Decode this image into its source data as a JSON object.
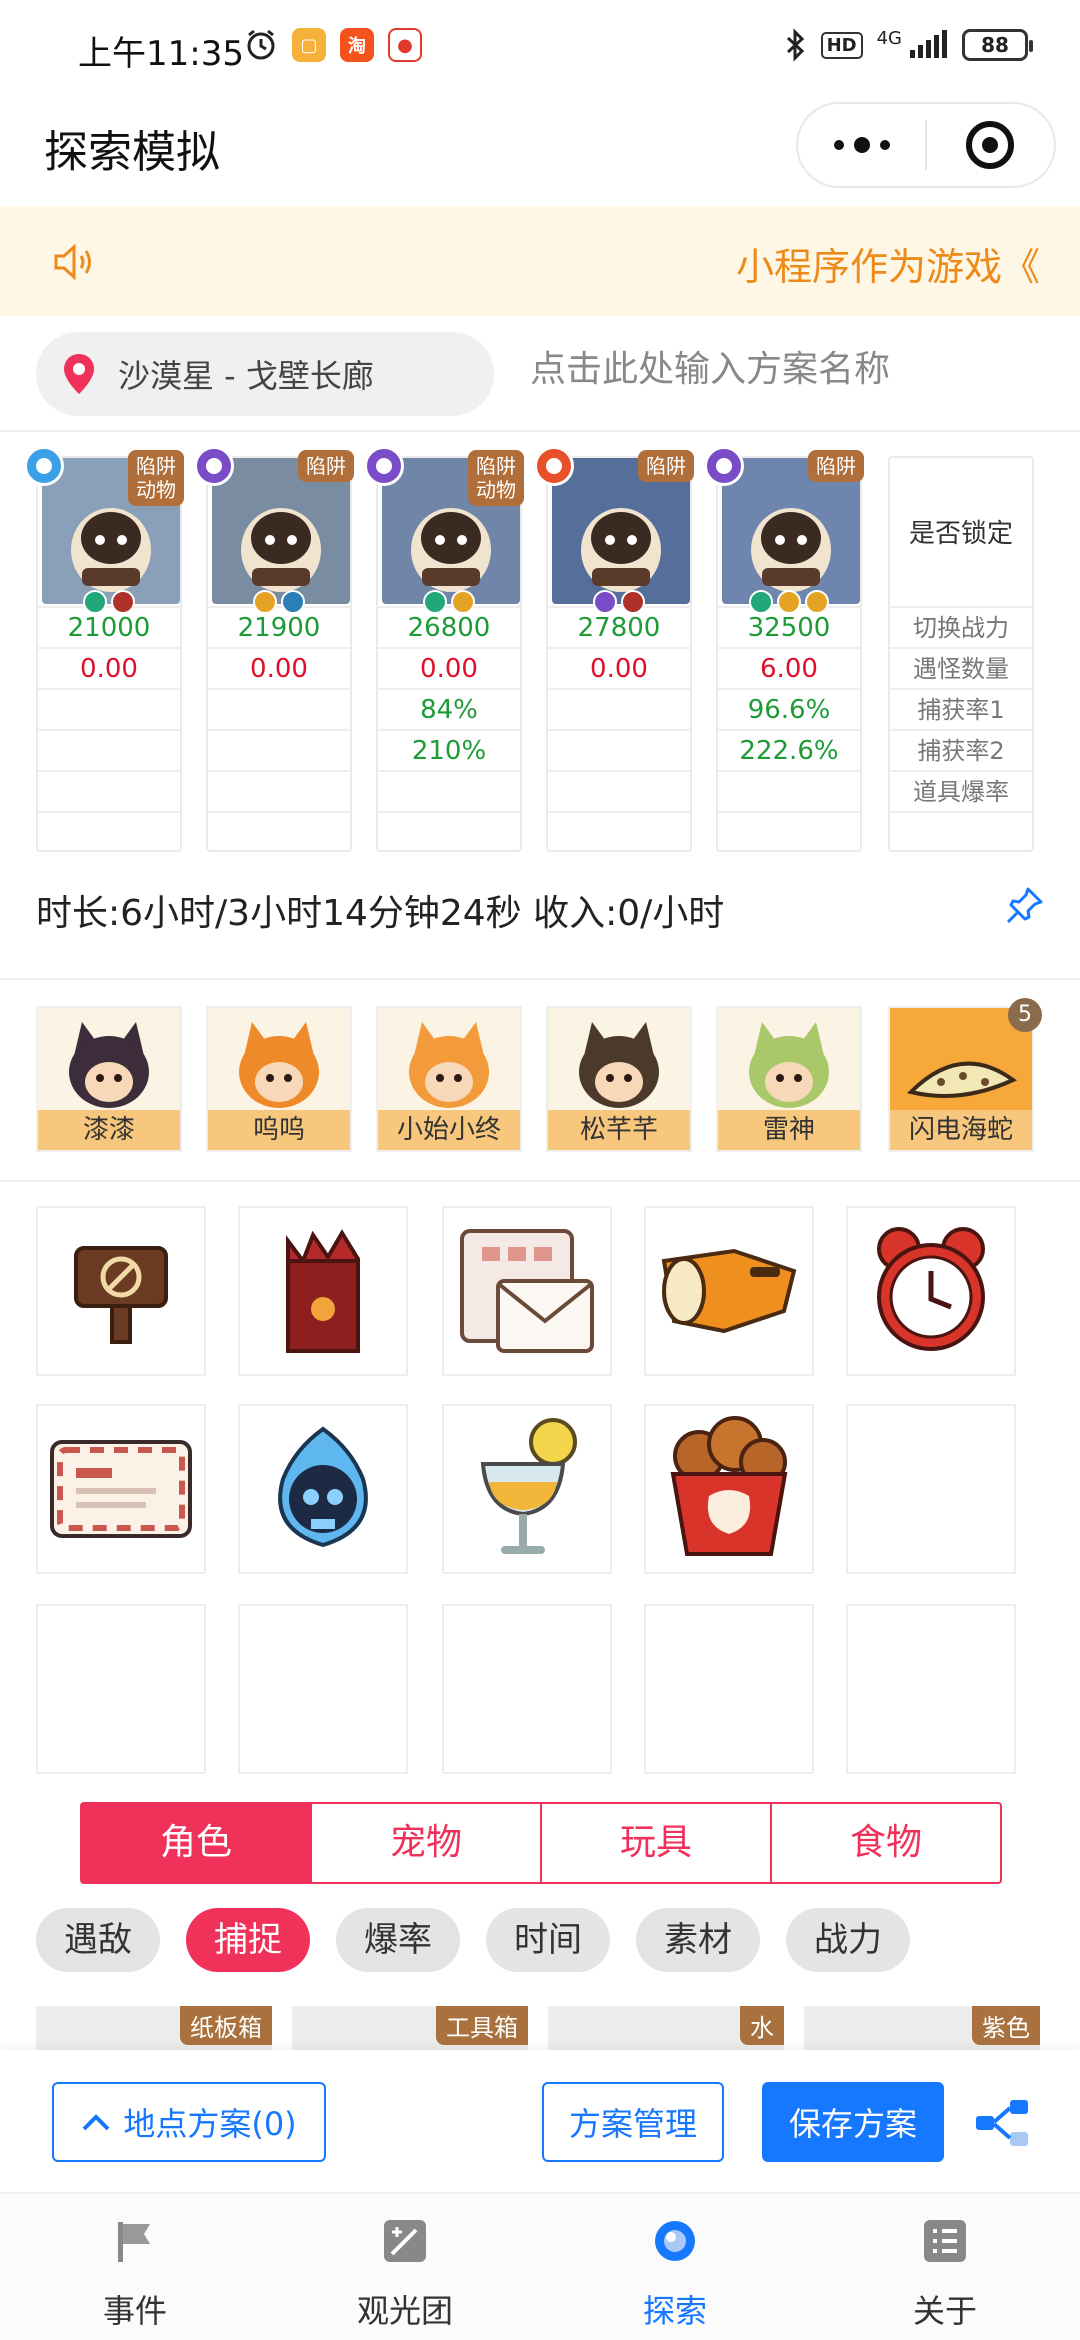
{
  "status_bar": {
    "time": "上午11:35",
    "network": "4G",
    "hd": "HD",
    "battery": "88",
    "apps": [
      "taobao-app-icon",
      "memo-app-icon",
      "red-envelope-app-icon"
    ]
  },
  "nav": {
    "title": "探索模拟"
  },
  "notice": {
    "text": "小程序作为游戏《"
  },
  "location": {
    "name": "沙漠星 - 戈壁长廊",
    "plan_placeholder": "点击此处输入方案名称"
  },
  "characters": [
    {
      "tag": "陷阱\n动物",
      "power": "21000",
      "monsters": "0.00",
      "catch1": "",
      "catch2": "",
      "badge_color": "#3aa0e8"
    },
    {
      "tag": "陷阱",
      "power": "21900",
      "monsters": "0.00",
      "catch1": "",
      "catch2": "",
      "badge_color": "#7a4cc8"
    },
    {
      "tag": "陷阱\n动物",
      "power": "26800",
      "monsters": "0.00",
      "catch1": "84%",
      "catch2": "210%",
      "badge_color": "#7a4cc8"
    },
    {
      "tag": "陷阱",
      "power": "27800",
      "monsters": "0.00",
      "catch1": "",
      "catch2": "",
      "badge_color": "#e8502a"
    },
    {
      "tag": "陷阱",
      "power": "32500",
      "monsters": "6.00",
      "catch1": "96.6%",
      "catch2": "222.6%",
      "badge_color": "#7a4cc8"
    }
  ],
  "lock_card": {
    "title": "是否锁定",
    "rows": [
      "切换战力",
      "遇怪数量",
      "捕获率1",
      "捕获率2",
      "道具爆率"
    ]
  },
  "duration_text": "时长:6小时/3小时14分钟24秒 收入:0/小时",
  "pets": [
    {
      "name": "漆漆"
    },
    {
      "name": "呜呜"
    },
    {
      "name": "小始小终"
    },
    {
      "name": "松芊芊"
    },
    {
      "name": "雷神"
    },
    {
      "name": "闪电海蛇",
      "count": "5"
    }
  ],
  "items": [
    "no-sign-board-icon",
    "red-bag-icon",
    "envelope-icon",
    "flashlight-icon",
    "alarm-clock-icon",
    "postcard-icon",
    "blue-skull-flame-icon",
    "lemon-drink-icon",
    "fried-chicken-bucket-icon",
    "",
    "",
    "",
    "",
    "",
    ""
  ],
  "segments": [
    "角色",
    "宠物",
    "玩具",
    "食物"
  ],
  "chips": [
    "遇敌",
    "捕捉",
    "爆率",
    "时间",
    "素材",
    "战力"
  ],
  "bottom_cards": [
    "纸板箱",
    "工具箱",
    "水",
    "紫色"
  ],
  "actions": {
    "location_plans": "地点方案(0)",
    "plan_manage": "方案管理",
    "save_plan": "保存方案"
  },
  "tabs": [
    "事件",
    "观光团",
    "探索",
    "关于"
  ],
  "colors": {
    "accent_red": "#f0325a",
    "accent_blue": "#1677ff",
    "notice_orange": "#ee8a1a",
    "power_green": "#1e9b36",
    "value_red": "#e0102a"
  }
}
